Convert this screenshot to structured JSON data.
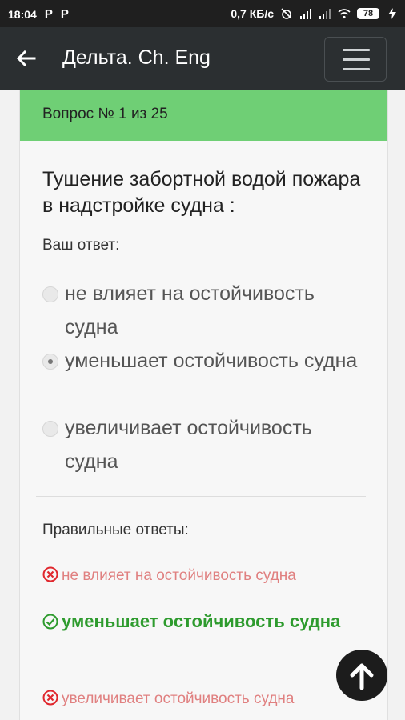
{
  "status_bar": {
    "time": "18:04",
    "notif_1": "P",
    "notif_2": "P",
    "net_speed": "0,7 КБ/с",
    "battery": "78"
  },
  "app_bar": {
    "title": "Дельта. Ch. Eng"
  },
  "quiz": {
    "counter": "Вопрос № 1 из 25",
    "question": "Тушение забортной водой пожара в надстройке судна :",
    "your_answer_label": "Ваш ответ:",
    "options": [
      {
        "label": "не влияет на остойчивость судна",
        "checked": false
      },
      {
        "label": "уменьшает остойчивость судна",
        "checked": true
      },
      {
        "label": "увеличивает остойчивость судна",
        "checked": false
      }
    ],
    "correct_label": "Правильные ответы:",
    "results": [
      {
        "text": "не влияет на остойчивость судна",
        "status": "wrong"
      },
      {
        "text": "уменьшает остойчивость судна",
        "status": "correct"
      },
      {
        "text": "увеличивает остойчивость судна",
        "status": "wrong"
      }
    ]
  },
  "colors": {
    "header_green": "#6fcf75",
    "correct_green": "#2e9b2e",
    "wrong_red": "#e08080",
    "app_bar": "#2b2f31"
  }
}
